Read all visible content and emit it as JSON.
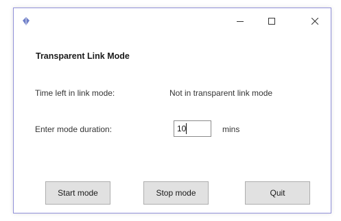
{
  "window": {
    "title": "",
    "icon": "feather-icon",
    "controls": {
      "minimize_icon": "minimize-icon",
      "maximize_icon": "maximize-icon",
      "close_icon": "close-icon"
    }
  },
  "panel": {
    "heading": "Transparent Link Mode",
    "time_left_label": "Time left in link mode:",
    "time_left_value": "Not in transparent link mode",
    "duration_label": "Enter mode duration:",
    "duration_value": "10",
    "duration_unit": "mins"
  },
  "buttons": {
    "start": "Start mode",
    "stop": "Stop mode",
    "quit": "Quit"
  },
  "colors": {
    "window_border": "#8f8fd8",
    "button_face": "#e1e1e1",
    "button_border": "#adadad"
  }
}
